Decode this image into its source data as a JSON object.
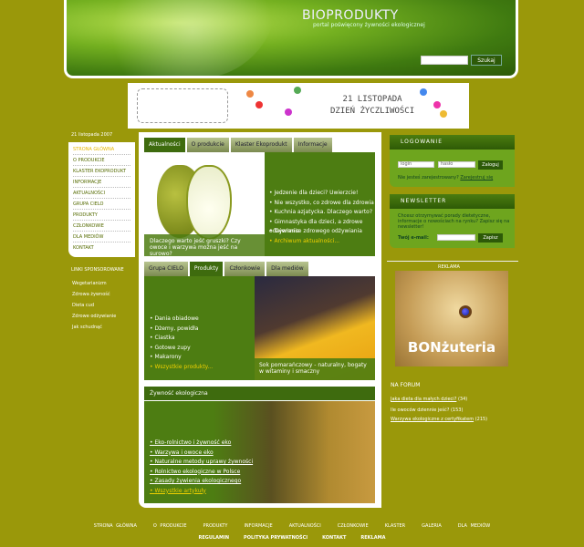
{
  "header": {
    "logo": "BIOPRODUKTY",
    "tagline": "portal poświęcony żywności ekologicznej",
    "search_placeholder": "",
    "search_button": "Szukaj"
  },
  "banner": {
    "line1": "21 LISTOPADA",
    "line2": "DZIEŃ ŻYCZLIWOŚCI"
  },
  "left": {
    "date": "21 listopada 2007",
    "menu": [
      "STRONA GŁÓWNA",
      "O PRODUKCIE",
      "KLASTER EKOPRODUKT",
      "INFORMACJE",
      "AKTUALNOŚCI",
      "GRUPA CIELO",
      "PRODUKTY",
      "CZŁONKOWIE",
      "DLA MEDIÓW",
      "KONTAKT"
    ],
    "sponsor_title": "LINKI SPONSOROWANE",
    "sponsor_links": [
      "Wegetarianizm",
      "Zdrowa żywność",
      "Dieta cud",
      "Zdrowe odżywianie",
      "Jak schudnąć"
    ]
  },
  "box1": {
    "tabs": [
      "Aktualności",
      "O produkcie",
      "Klaster Ekoprodukt",
      "Informacje"
    ],
    "caption": "Dlaczego warto jeść gruszki? Czy owoce i warzywa można jeść na surowo?",
    "items": [
      "Jedzenie dla dzieci? Uwierzcie!",
      "Nie wszystko, co zdrowe dla zdrowia",
      "Kuchnia azjatycka. Dlaczego warto?",
      "Gimnastyka dla dzieci, a zdrowe odżywianie",
      "Tajemnice zdrowego odżywiania"
    ],
    "more": "Archiwum aktualności..."
  },
  "box2": {
    "tabs": [
      "Grupa CIELO",
      "Produkty",
      "Członkowie",
      "Dla mediów"
    ],
    "items": [
      "Dania obiadowe",
      "Dżemy, powidła",
      "Ciastka",
      "Gotowe zupy",
      "Makarony"
    ],
    "more": "Wszystkie produkty...",
    "caption": "Sok pomarańczowy - naturalny, bogaty w witaminy i smaczny"
  },
  "box3": {
    "title": "Żywność ekologiczna",
    "items": [
      "Eko-rolnictwo i żywność eko",
      "Warzywa i owoce eko",
      "Naturalne metody uprawy żywności",
      "Rolnictwo ekologiczne w Polsce",
      "Zasady żywienia ekologicznego"
    ],
    "more": "Wszystkie artykuły"
  },
  "login": {
    "title": "LOGOWANIE",
    "user_value": "login",
    "pass_value": "hasło",
    "button": "Zaloguj",
    "register_q": "Nie jesteś zarejestrowany?",
    "register_link": "Zarejestruj się"
  },
  "newsletter": {
    "title": "NEWSLETTER",
    "text": "Chcesz otrzymywać porady dietetyczne, informacje o nowościach na rynku? Zapisz się na newsletter!",
    "label": "Twój e-mail:",
    "button": "Zapisz"
  },
  "ad": {
    "label": "REKLAMA",
    "brand": "BONżuteria"
  },
  "forum": {
    "title": "NA FORUM",
    "links": [
      {
        "text": "Jaka dieta dla małych dzieci?",
        "count": "(34)"
      },
      {
        "text": "Ile owoców dziennie jeść?",
        "count": "(153)"
      },
      {
        "text": "Warzywa ekologiczne z certyfikatem",
        "count": "(215)"
      }
    ]
  },
  "footer": {
    "links": [
      "STRONA GŁÓWNA",
      "O PRODUKCIE",
      "PRODUKTY",
      "INFORMACJE",
      "AKTUALNOŚCI",
      "CZŁONKOWIE",
      "KLASTER",
      "GALERIA",
      "DLA MEDIÓW"
    ],
    "links2": [
      "REGULAMIN",
      "POLITYKA PRYWATNOŚCI",
      "KONTAKT",
      "REKLAMA"
    ]
  }
}
